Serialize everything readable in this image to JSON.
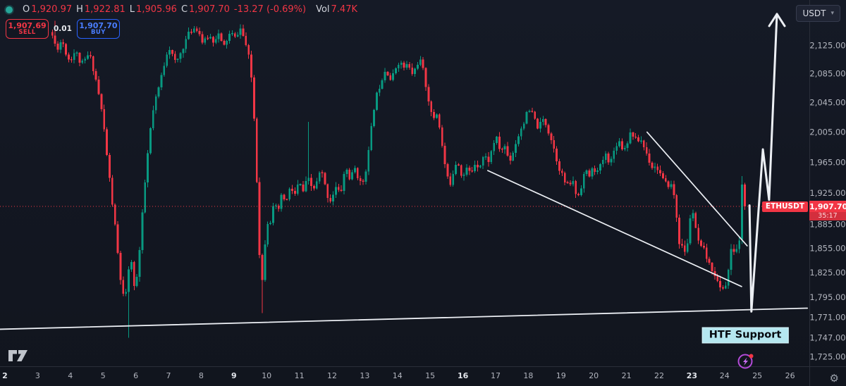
{
  "colors": {
    "background": "#131722",
    "panel_border": "#2a2e39",
    "up": "#089981",
    "down": "#f23645",
    "accent_red": "#f23645",
    "accent_blue": "#2962ff",
    "drawing_white": "#eceff4",
    "axis_text": "#b2b5be",
    "axis_text_bold": "#e3e6ec",
    "htf_bg": "#b5e7f0",
    "spark_purple": "#b44bd9"
  },
  "legend": {
    "open_label": "O",
    "open": "1,920.97",
    "high_label": "H",
    "high": "1,922.81",
    "low_label": "L",
    "low": "1,905.96",
    "close_label": "C",
    "close": "1,907.70",
    "change": "-13.27 (-0.69%)",
    "vol_label": "Vol",
    "vol": "7.47K"
  },
  "order_panel": {
    "sell_price": "1,907.69",
    "sell_label": "SELL",
    "spread": "0.01",
    "buy_price": "1,907.70",
    "buy_label": "BUY"
  },
  "currency_selector": {
    "label": "USDT",
    "chevron": "▾"
  },
  "price_tag": {
    "symbol": "ETHUSDT",
    "price": "1,907.70",
    "countdown": "35:17",
    "value": 1907.7
  },
  "annotations": {
    "htf_support": {
      "text": "HTF Support",
      "day": 24.63,
      "price": 1750
    }
  },
  "price_axis": {
    "labels": [
      {
        "text": "2,125.00",
        "price": 2125
      },
      {
        "text": "2,085.00",
        "price": 2085
      },
      {
        "text": "2,045.00",
        "price": 2045
      },
      {
        "text": "2,005.00",
        "price": 2005
      },
      {
        "text": "1,965.00",
        "price": 1965
      },
      {
        "text": "1,925.00",
        "price": 1925
      },
      {
        "text": "1,885.00",
        "price": 1885
      },
      {
        "text": "1,855.00",
        "price": 1855
      },
      {
        "text": "1,825.00",
        "price": 1825
      },
      {
        "text": "1,795.00",
        "price": 1795
      },
      {
        "text": "1,771.00",
        "price": 1771
      },
      {
        "text": "1,747.00",
        "price": 1747
      },
      {
        "text": "1,725.00",
        "price": 1725
      }
    ]
  },
  "time_axis": {
    "days": [
      {
        "label": "2",
        "day": 2,
        "bold": true
      },
      {
        "label": "3",
        "day": 3,
        "bold": false
      },
      {
        "label": "4",
        "day": 4,
        "bold": false
      },
      {
        "label": "5",
        "day": 5,
        "bold": false
      },
      {
        "label": "6",
        "day": 6,
        "bold": false
      },
      {
        "label": "7",
        "day": 7,
        "bold": false
      },
      {
        "label": "8",
        "day": 8,
        "bold": false
      },
      {
        "label": "9",
        "day": 9,
        "bold": true
      },
      {
        "label": "10",
        "day": 10,
        "bold": false
      },
      {
        "label": "11",
        "day": 11,
        "bold": false
      },
      {
        "label": "12",
        "day": 12,
        "bold": false
      },
      {
        "label": "13",
        "day": 13,
        "bold": false
      },
      {
        "label": "14",
        "day": 14,
        "bold": false
      },
      {
        "label": "15",
        "day": 15,
        "bold": false
      },
      {
        "label": "16",
        "day": 16,
        "bold": true
      },
      {
        "label": "17",
        "day": 17,
        "bold": false
      },
      {
        "label": "18",
        "day": 18,
        "bold": false
      },
      {
        "label": "19",
        "day": 19,
        "bold": false
      },
      {
        "label": "20",
        "day": 20,
        "bold": false
      },
      {
        "label": "21",
        "day": 21,
        "bold": false
      },
      {
        "label": "22",
        "day": 22,
        "bold": false
      },
      {
        "label": "23",
        "day": 23,
        "bold": true
      },
      {
        "label": "24",
        "day": 24,
        "bold": false
      },
      {
        "label": "25",
        "day": 25,
        "bold": false
      },
      {
        "label": "26",
        "day": 26,
        "bold": false
      }
    ]
  },
  "chart_data": {
    "type": "candlestick",
    "symbol": "ETHUSDT",
    "quote_currency": "USDT",
    "current_price": 1907.7,
    "y_axis": {
      "scale": "log",
      "visible_price_range": [
        1714,
        2190
      ]
    },
    "x_axis": {
      "first_day": 2,
      "last_day": 26,
      "candles_per_day": 12,
      "series_start_day": 3.45,
      "series_end_day": 24.69
    },
    "close_path": [
      [
        3.47,
        2144
      ],
      [
        3.62,
        2119
      ],
      [
        3.79,
        2134
      ],
      [
        4,
        2100
      ],
      [
        4.18,
        2119
      ],
      [
        4.39,
        2095
      ],
      [
        4.61,
        2114
      ],
      [
        4.82,
        2080
      ],
      [
        5.04,
        2022
      ],
      [
        5.25,
        1938
      ],
      [
        5.43,
        1875
      ],
      [
        5.56,
        1818
      ],
      [
        5.69,
        1788
      ],
      [
        5.75,
        1786
      ],
      [
        5.86,
        1857
      ],
      [
        5.99,
        1797
      ],
      [
        6.12,
        1831
      ],
      [
        6.25,
        1901
      ],
      [
        6.38,
        1965
      ],
      [
        6.55,
        2031
      ],
      [
        6.72,
        2060
      ],
      [
        6.89,
        2095
      ],
      [
        7.06,
        2129
      ],
      [
        7.24,
        2095
      ],
      [
        7.41,
        2114
      ],
      [
        7.58,
        2134
      ],
      [
        7.75,
        2148
      ],
      [
        7.93,
        2152
      ],
      [
        8.1,
        2124
      ],
      [
        8.25,
        2141
      ],
      [
        8.44,
        2129
      ],
      [
        8.57,
        2149
      ],
      [
        8.7,
        2119
      ],
      [
        8.83,
        2134
      ],
      [
        8.96,
        2144
      ],
      [
        9.09,
        2129
      ],
      [
        9.22,
        2156
      ],
      [
        9.35,
        2134
      ],
      [
        9.48,
        2114
      ],
      [
        9.61,
        2070
      ],
      [
        9.71,
        1975
      ],
      [
        9.8,
        1884
      ],
      [
        9.86,
        1797
      ],
      [
        9.95,
        1831
      ],
      [
        10.04,
        1901
      ],
      [
        10.15,
        1875
      ],
      [
        10.25,
        1919
      ],
      [
        10.38,
        1893
      ],
      [
        10.51,
        1929
      ],
      [
        10.64,
        1906
      ],
      [
        10.77,
        1938
      ],
      [
        10.9,
        1915
      ],
      [
        11.03,
        1942
      ],
      [
        11.16,
        1919
      ],
      [
        11.29,
        1947
      ],
      [
        11.42,
        1929
      ],
      [
        11.55,
        1933
      ],
      [
        11.7,
        1956
      ],
      [
        11.85,
        1929
      ],
      [
        12,
        1910
      ],
      [
        12.15,
        1938
      ],
      [
        12.3,
        1919
      ],
      [
        12.45,
        1961
      ],
      [
        12.6,
        1938
      ],
      [
        12.75,
        1965
      ],
      [
        12.91,
        1929
      ],
      [
        13.06,
        1951
      ],
      [
        13.21,
        1993
      ],
      [
        13.31,
        2041
      ],
      [
        13.44,
        2060
      ],
      [
        13.57,
        2080
      ],
      [
        13.7,
        2095
      ],
      [
        13.83,
        2070
      ],
      [
        13.96,
        2090
      ],
      [
        14.09,
        2107
      ],
      [
        14.22,
        2090
      ],
      [
        14.35,
        2101
      ],
      [
        14.48,
        2080
      ],
      [
        14.61,
        2095
      ],
      [
        14.74,
        2110
      ],
      [
        14.86,
        2080
      ],
      [
        14.99,
        2051
      ],
      [
        15.12,
        2017
      ],
      [
        15.25,
        2041
      ],
      [
        15.38,
        1993
      ],
      [
        15.51,
        1956
      ],
      [
        15.64,
        1929
      ],
      [
        15.77,
        1961
      ],
      [
        15.9,
        1970
      ],
      [
        16.03,
        1942
      ],
      [
        16.16,
        1961
      ],
      [
        16.29,
        1947
      ],
      [
        16.42,
        1970
      ],
      [
        16.55,
        1956
      ],
      [
        16.68,
        1979
      ],
      [
        16.81,
        1961
      ],
      [
        16.94,
        1984
      ],
      [
        17.06,
        2003
      ],
      [
        17.19,
        1975
      ],
      [
        17.32,
        1993
      ],
      [
        17.45,
        1965
      ],
      [
        17.58,
        1979
      ],
      [
        17.71,
        1998
      ],
      [
        17.84,
        2012
      ],
      [
        17.97,
        2027
      ],
      [
        18.1,
        2036
      ],
      [
        18.23,
        2022
      ],
      [
        18.36,
        2008
      ],
      [
        18.49,
        2027
      ],
      [
        18.61,
        2012
      ],
      [
        18.74,
        1998
      ],
      [
        18.87,
        1975
      ],
      [
        19,
        1956
      ],
      [
        19.13,
        1942
      ],
      [
        19.26,
        1929
      ],
      [
        19.39,
        1947
      ],
      [
        19.52,
        1915
      ],
      [
        19.65,
        1933
      ],
      [
        19.78,
        1956
      ],
      [
        19.91,
        1942
      ],
      [
        20.04,
        1961
      ],
      [
        20.16,
        1947
      ],
      [
        20.29,
        1965
      ],
      [
        20.42,
        1979
      ],
      [
        20.55,
        1961
      ],
      [
        20.68,
        1984
      ],
      [
        20.81,
        1998
      ],
      [
        20.94,
        1979
      ],
      [
        21.07,
        1993
      ],
      [
        21.2,
        2008
      ],
      [
        21.33,
        1989
      ],
      [
        21.46,
        1998
      ],
      [
        21.59,
        1984
      ],
      [
        21.72,
        1970
      ],
      [
        21.84,
        1956
      ],
      [
        21.97,
        1961
      ],
      [
        22.1,
        1947
      ],
      [
        22.23,
        1933
      ],
      [
        22.36,
        1938
      ],
      [
        22.49,
        1929
      ],
      [
        22.6,
        1884
      ],
      [
        22.69,
        1848
      ],
      [
        22.78,
        1862
      ],
      [
        22.86,
        1840
      ],
      [
        22.95,
        1875
      ],
      [
        23.01,
        1925
      ],
      [
        23.08,
        1893
      ],
      [
        23.16,
        1875
      ],
      [
        23.25,
        1862
      ],
      [
        23.34,
        1848
      ],
      [
        23.42,
        1857
      ],
      [
        23.51,
        1840
      ],
      [
        23.59,
        1827
      ],
      [
        23.68,
        1835
      ],
      [
        23.77,
        1818
      ],
      [
        23.85,
        1810
      ],
      [
        23.94,
        1801
      ],
      [
        24.02,
        1814
      ],
      [
        24.11,
        1805
      ],
      [
        24.2,
        1848
      ],
      [
        24.26,
        1857
      ],
      [
        24.33,
        1847
      ],
      [
        24.39,
        1853
      ],
      [
        24.46,
        1859
      ],
      [
        24.52,
        1864
      ],
      [
        24.58,
        1875
      ],
      [
        24.63,
        1942
      ],
      [
        24.69,
        1908
      ]
    ],
    "wick_events": [
      {
        "day": 3.55,
        "high": 2160
      },
      {
        "day": 5.75,
        "low": 1747
      },
      {
        "day": 9.86,
        "low": 1776
      },
      {
        "day": 11.27,
        "high": 2019
      },
      {
        "day": 24.63,
        "high": 1947
      }
    ],
    "last_candles": [
      {
        "open": 1866,
        "close": 1936,
        "high": 1947,
        "low": 1860
      },
      {
        "open": 1936,
        "close": 1907.7,
        "high": 1938,
        "low": 1903
      }
    ],
    "drawings": {
      "support_line": {
        "name": "HTF ascending support",
        "from": [
          1.85,
          1757
        ],
        "to": [
          26.53,
          1782
        ]
      },
      "trendlines": [
        {
          "name": "descending resistance long",
          "from": [
            16.76,
            1954
          ],
          "to": [
            24.52,
            1808
          ]
        },
        {
          "name": "descending resistance short",
          "from": [
            21.63,
            2005
          ],
          "to": [
            24.69,
            1858
          ]
        }
      ],
      "projection_arrow": {
        "name": "bullish projection zigzag",
        "points": [
          [
            24.76,
            1909
          ],
          [
            24.82,
            1778
          ],
          [
            25.17,
            1982
          ],
          [
            25.36,
            1916
          ],
          [
            25.6,
            2170
          ]
        ]
      }
    }
  }
}
